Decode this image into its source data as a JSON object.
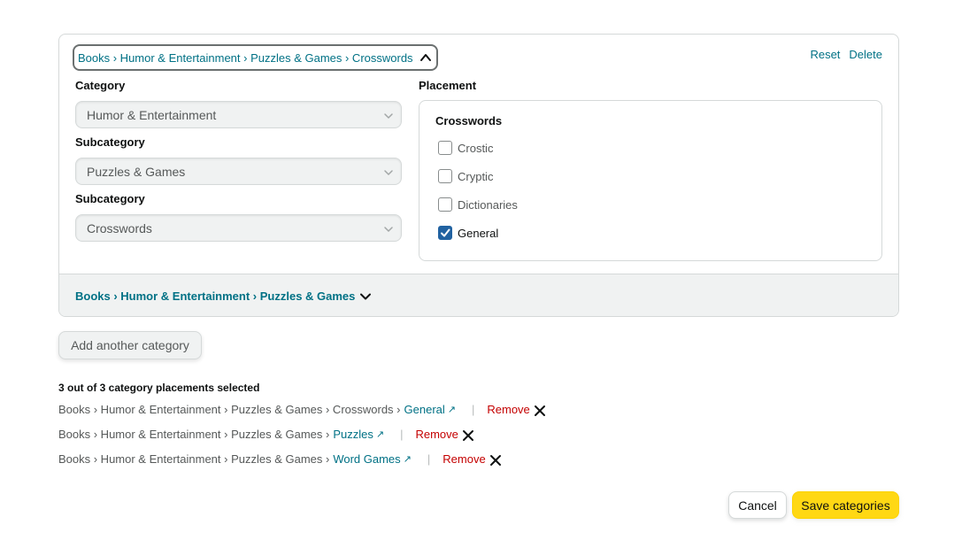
{
  "editor": {
    "breadcrumb": "Books › Humor & Entertainment › Puzzles & Games › Crosswords",
    "reset_label": "Reset",
    "delete_label": "Delete",
    "category_label": "Category",
    "category_value": "Humor & Entertainment",
    "subcategory1_label": "Subcategory",
    "subcategory1_value": "Puzzles & Games",
    "subcategory2_label": "Subcategory",
    "subcategory2_value": "Crosswords",
    "placement_label": "Placement",
    "placement_group_title": "Crosswords",
    "placements": [
      {
        "label": "Crostic",
        "checked": false
      },
      {
        "label": "Cryptic",
        "checked": false
      },
      {
        "label": "Dictionaries",
        "checked": false
      },
      {
        "label": "General",
        "checked": true
      }
    ],
    "collapsed_breadcrumb": "Books › Humor & Entertainment › Puzzles & Games"
  },
  "add_category_label": "Add another category",
  "summary": {
    "title": "3 out of 3 category placements selected",
    "rows": [
      {
        "path": "Books › Humor & Entertainment › Puzzles & Games › Crosswords ›",
        "leaf": "General",
        "remove": "Remove"
      },
      {
        "path": "Books › Humor & Entertainment › Puzzles & Games ›",
        "leaf": "Puzzles",
        "remove": "Remove"
      },
      {
        "path": "Books › Humor & Entertainment › Puzzles & Games ›",
        "leaf": "Word Games",
        "remove": "Remove"
      }
    ],
    "separator": "|",
    "external_link_icon": "↗"
  },
  "buttons": {
    "cancel": "Cancel",
    "save": "Save categories"
  },
  "colors": {
    "link": "#007185",
    "remove": "#c40000",
    "primary_button": "#ffd814",
    "checkbox_checked": "#2162a1"
  },
  "icons": {
    "breadcrumb_toggle": "chevron-up-icon",
    "select_caret": "chevron-down-icon",
    "collapsed_toggle": "chevron-down-icon",
    "remove": "close-icon",
    "external": "external-link-icon"
  }
}
